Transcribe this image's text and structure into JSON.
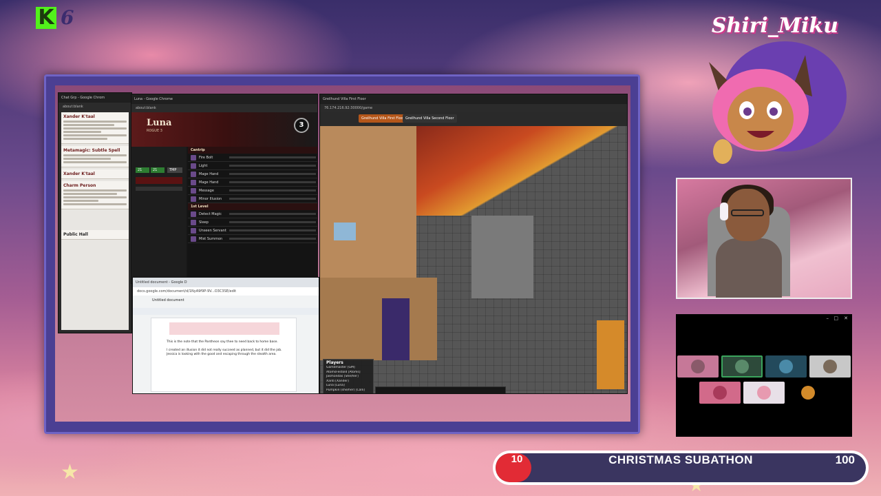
{
  "brand": {
    "letter": "K",
    "number": "6"
  },
  "streamer": {
    "name": "Shiri_Miku"
  },
  "chat_window": {
    "title": "Chat Grp - Google Chrom",
    "url": "about:blank",
    "entries": [
      {
        "name": "Xander K'taal"
      },
      {
        "name": "Metamagic: Subtle Spell"
      },
      {
        "name": "Xander K'taal"
      },
      {
        "name": "Charm Person"
      }
    ],
    "footer": "Public Hall"
  },
  "sheet_window": {
    "title": "Luna - Google Chrome",
    "url": "about:blank",
    "character_name": "Luna",
    "character_class": "ROGUE 3",
    "level": "3",
    "hp_current": "21",
    "hp_max": "21",
    "hp_temp": "TMP",
    "sections": [
      "Cantrip",
      "1st Level"
    ],
    "cantrips": [
      "Fire Bolt",
      "Light",
      "Mage Hand",
      "Mage Hand",
      "Message",
      "Minor Illusion"
    ],
    "first_level": [
      "Detect Magic",
      "Sleep",
      "Unseen Servant",
      "Mist Summon"
    ]
  },
  "doc_window": {
    "tab": "Untitled document - Google D",
    "url": "docs.google.com/document/d/1NyA9f9P-9V...O3C3SE/edit",
    "title": "Untitled document",
    "line1": "This is the note that the Pantheon say thee to need back to home base.",
    "line2": "I created an illusion it did not really succeed as planned, but it did the job. Jessica is looking with the good and escaping through the stealth area."
  },
  "vtt_window": {
    "tab": "Greilhund Villa First Floor",
    "url": "76.174.216.92:30000/game",
    "pages": [
      "Greilhund Villa First Floor",
      "Greilhund Villa Second Floor"
    ],
    "players_title": "Players",
    "players": [
      "Gamemaster [GM]",
      "AtomsFestold [Atoms]",
      "Jasmondas [She/her]",
      "Xanti [Xander]",
      "Luna [Luna]",
      "Pumpkin (she/her) [Calli]"
    ]
  },
  "call_panel": {
    "participants": 7
  },
  "subathon": {
    "label": "CHRISTMAS SUBATHON",
    "min": "10",
    "max": "100",
    "progress_fraction": 0.09,
    "colors": {
      "fill": "#e22b35",
      "track": "#3a3560"
    }
  }
}
